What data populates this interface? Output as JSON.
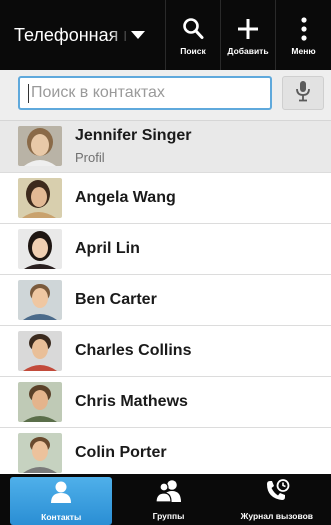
{
  "topbar": {
    "phonebook_label": "Телефонная книга",
    "actions": [
      {
        "label": "Поиск",
        "icon": "search-icon"
      },
      {
        "label": "Добавить",
        "icon": "plus-icon"
      },
      {
        "label": "Меню",
        "icon": "overflow-menu-icon"
      }
    ]
  },
  "search": {
    "placeholder": "Поиск в контактах",
    "mic_icon": "microphone-icon"
  },
  "profile": {
    "name": "Jennifer Singer",
    "subtitle": "Profil"
  },
  "contacts": [
    {
      "name": "Angela Wang"
    },
    {
      "name": "April Lin"
    },
    {
      "name": "Ben Carter"
    },
    {
      "name": "Charles Collins"
    },
    {
      "name": "Chris Mathews"
    },
    {
      "name": "Colin Porter"
    }
  ],
  "tabs": [
    {
      "label": "Контакты",
      "icon": "person-icon",
      "active": true
    },
    {
      "label": "Группы",
      "icon": "group-icon",
      "active": false
    },
    {
      "label": "Журнал вызовов",
      "icon": "call-history-icon",
      "active": false
    }
  ],
  "colors": {
    "accent": "#2a8ed4",
    "search_border": "#5fa9dc",
    "bar_background": "#0a0a0a"
  }
}
